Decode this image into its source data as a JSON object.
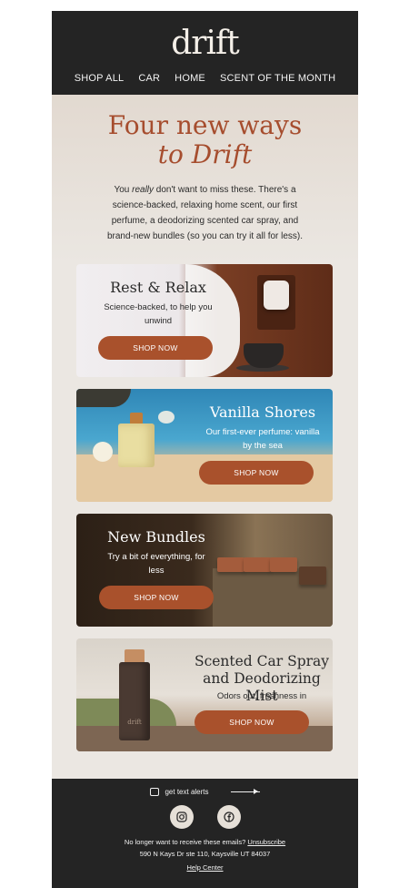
{
  "header": {
    "logo": "drift",
    "nav": [
      "SHOP ALL",
      "CAR",
      "HOME",
      "SCENT OF THE MONTH"
    ]
  },
  "hero": {
    "title_line1": "Four new ways",
    "title_line2": "to Drift",
    "body_pre": "You ",
    "body_em": "really",
    "body_post": " don't want to miss these. There's a science-backed, relaxing home scent, our first perfume, a deodorizing scented car spray, and brand-new bundles (so you can try it all for less)."
  },
  "cards": [
    {
      "title": "Rest & Relax",
      "subtitle": "Science-backed, to help you unwind",
      "button": "SHOP NOW"
    },
    {
      "title": "Vanilla Shores",
      "subtitle": "Our first-ever perfume: vanilla by the sea",
      "button": "SHOP NOW"
    },
    {
      "title": "New Bundles",
      "subtitle": "Try a bit of everything, for less",
      "button": "SHOP NOW"
    },
    {
      "title": "Scented Car Spray and Deodorizing Mist",
      "subtitle": "Odors out, freshness in",
      "button": "SHOP NOW",
      "bottle_label": "drift"
    }
  ],
  "footer": {
    "alerts": "get text alerts",
    "unsubscribe_text": "No longer want to receive these emails? ",
    "unsubscribe_link": "Unsubscribe",
    "address": "590 N Kays Dr ste 110, Kaysville UT 84037",
    "help": "Help Center",
    "social_icons": [
      "instagram-icon",
      "facebook-icon"
    ]
  },
  "colors": {
    "header_bg": "#242424",
    "accent": "#a64d2e",
    "button": "#a9512c",
    "page_bg": "#ebe7e2"
  }
}
